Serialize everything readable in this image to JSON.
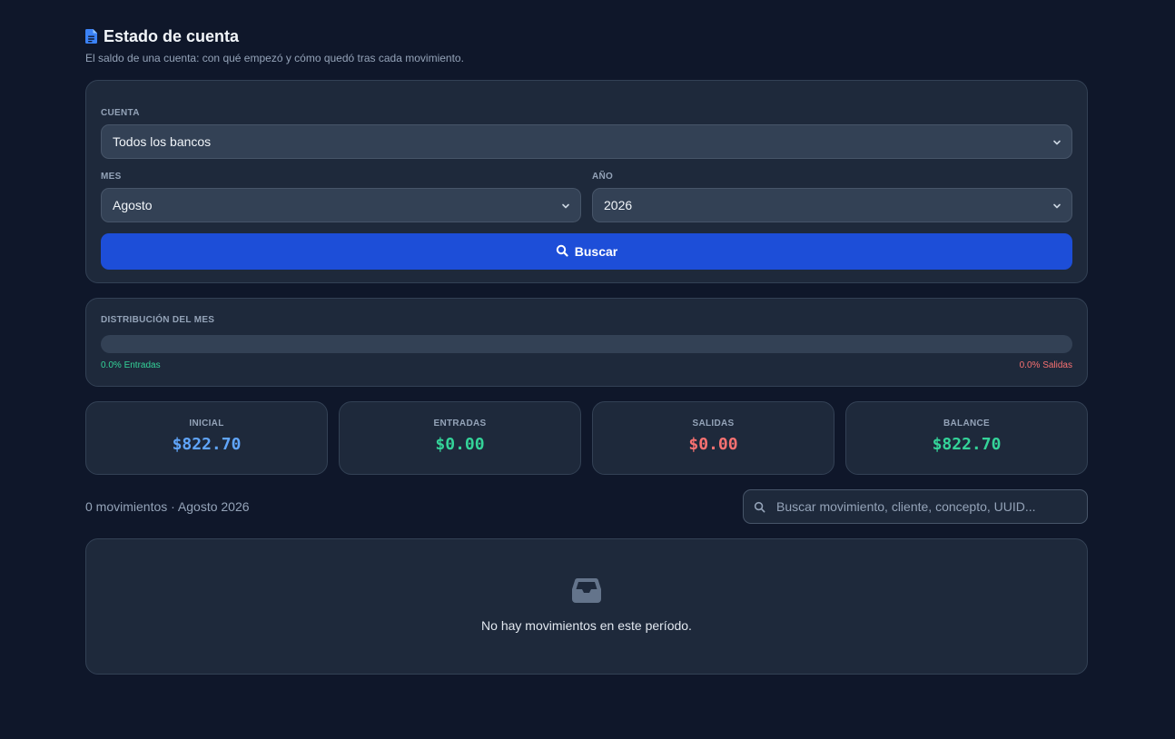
{
  "header": {
    "title": "Estado de cuenta",
    "subtitle": "El saldo de una cuenta: con qué empezó y cómo quedó tras cada movimiento."
  },
  "filters": {
    "account_label": "CUENTA",
    "account_value": "Todos los bancos",
    "month_label": "MES",
    "month_value": "Agosto",
    "year_label": "AÑO",
    "year_value": "2026",
    "search_button": "Buscar"
  },
  "distribution": {
    "label": "DISTRIBUCIÓN DEL MES",
    "in_percent": 0,
    "out_percent": 0,
    "in_text": "0.0% Entradas",
    "out_text": "0.0% Salidas"
  },
  "stats": [
    {
      "label": "INICIAL",
      "value": "$822.70"
    },
    {
      "label": "ENTRADAS",
      "value": "$0.00"
    },
    {
      "label": "SALIDAS",
      "value": "$0.00"
    },
    {
      "label": "BALANCE",
      "value": "$822.70"
    }
  ],
  "list": {
    "count_text": "0 movimientos · Agosto 2026",
    "search_placeholder": "Buscar movimiento, cliente, concepto, UUID..."
  },
  "empty": {
    "message": "No hay movimientos en este período.",
    "icon": "inbox-icon"
  },
  "colors": {
    "background": "#0f172a",
    "card": "#1e293b",
    "accent": "#1d4ed8",
    "positive": "#34d399",
    "negative": "#f87171",
    "initial": "#60a5fa"
  }
}
